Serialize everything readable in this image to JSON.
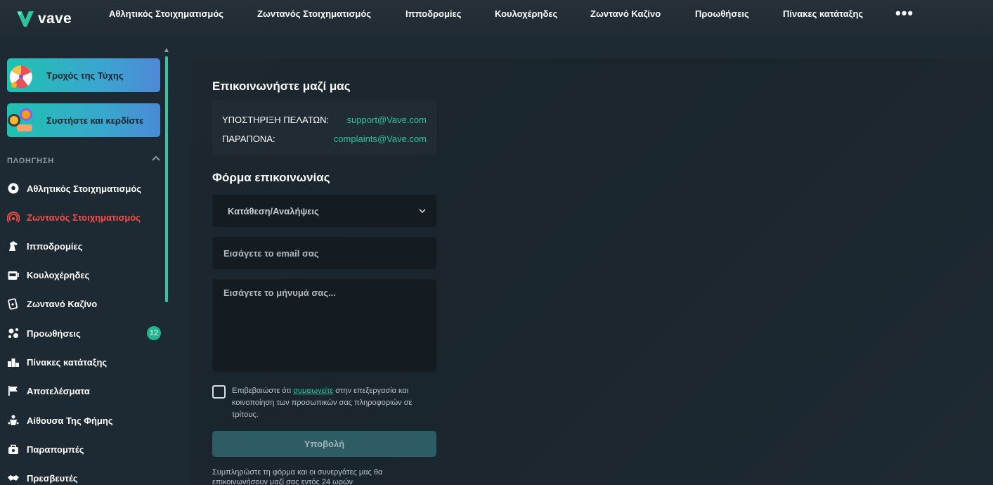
{
  "brand": {
    "name": "vave",
    "accent": "#2ec59d"
  },
  "topnav": {
    "items": [
      "Αθλητικός Στοιχηματισμός",
      "Ζωντανός Στοιχηματισμός",
      "Ιπποδρομίες",
      "Κουλοχέρηδες",
      "Ζωντανό Καζίνο",
      "Προωθήσεις",
      "Πίνακες κατάταξης"
    ],
    "more": "•••"
  },
  "sidebar": {
    "promos": [
      {
        "label": "Τροχός της Τύχης",
        "icon": "wheel-of-fortune-icon"
      },
      {
        "label": "Συστήστε και κερδίστε",
        "icon": "referral-coins-icon"
      }
    ],
    "section_title": "ΠΛΟΗΓΗΣΗ",
    "items": [
      {
        "label": "Αθλητικός Στοιχηματισμός",
        "icon": "soccer-ball-icon"
      },
      {
        "label": "Ζωντανός Στοιχηματισμός",
        "icon": "live-broadcast-icon",
        "active": true
      },
      {
        "label": "Ιπποδρομίες",
        "icon": "horse-icon"
      },
      {
        "label": "Κουλοχέρηδες",
        "icon": "slot-machine-icon"
      },
      {
        "label": "Ζωντανό Καζίνο",
        "icon": "playing-cards-icon"
      },
      {
        "label": "Προωθήσεις",
        "icon": "promotions-icon",
        "badge": "12"
      },
      {
        "label": "Πίνακες κατάταξης",
        "icon": "leaderboard-icon"
      },
      {
        "label": "Αποτελέσματα",
        "icon": "flag-icon"
      },
      {
        "label": "Αίθουσα Της Φήμης",
        "icon": "hall-of-fame-icon"
      },
      {
        "label": "Παραπομπές",
        "icon": "referrals-icon"
      },
      {
        "label": "Πρεσβευτές",
        "icon": "handshake-icon"
      }
    ]
  },
  "contact": {
    "title": "Επικοινωνήστε μαζί μας",
    "rows": [
      {
        "label": "ΥΠΟΣΤΗΡΙΞΗ ΠΕΛΑΤΩΝ:",
        "value": "support@Vave.com"
      },
      {
        "label": "ΠΑΡΑΠΟΝΑ:",
        "value": "complaints@Vave.com"
      }
    ]
  },
  "form": {
    "title": "Φόρμα επικοινωνίας",
    "topic_selected": "Κατάθεση/Αναλήψεις",
    "email_placeholder": "Εισάγετε το email σας",
    "message_placeholder": "Εισάγετε το μήνυμά σας...",
    "consent_before": "Επιβεβαιώστε ότι ",
    "consent_link": "συμφωνείτε",
    "consent_after": " στην επεξεργασία και κοινοποίηση των προσωπικών σας πληροφοριών σε τρίτους.",
    "submit_label": "Υποβολή",
    "footnote": "Συμπληρώστε τη φόρμα και οι συνεργάτες μας θα επικοινωνήσουν μαζί σας εντός 24 ωρών"
  }
}
